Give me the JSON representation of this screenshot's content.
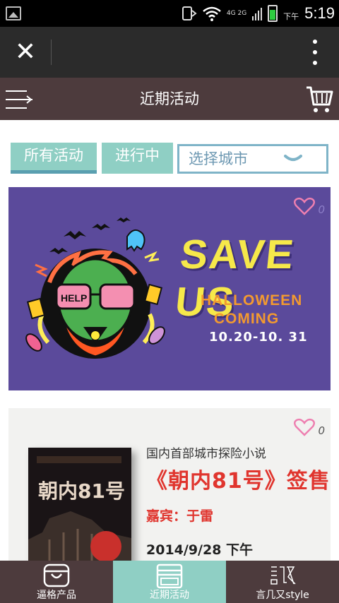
{
  "status_bar": {
    "network": "4G 2G",
    "ampm": "下午",
    "time": "5:19"
  },
  "top_bar": {
    "close_icon": "close-icon",
    "more_icon": "more-vertical-icon"
  },
  "nav": {
    "title": "近期活动",
    "menu_icon": "menu-arrow-icon",
    "cart_icon": "cart-icon"
  },
  "filters": {
    "all": "所有活动",
    "ongoing": "进行中",
    "city_label": "选择城市",
    "city_icon": "chevron-down-icon"
  },
  "events": [
    {
      "likes": "0",
      "heading": "SAVE US",
      "subheading_line1": "HALLOWEEN",
      "subheading_line2": "COMING",
      "dates": "10.20-10. 31",
      "sign_text": "HELP"
    },
    {
      "likes": "0",
      "book_title": "朝内81号",
      "subtitle": "国内首部城市探险小说",
      "title": "《朝内81号》签售",
      "guest": "嘉宾：于雷",
      "date": "2014/9/28 下午"
    }
  ],
  "bottom_nav": [
    {
      "label": "逼格产品",
      "icon": "bag-icon"
    },
    {
      "label": "近期活动",
      "icon": "calendar-icon"
    },
    {
      "label": "言几又style",
      "icon": "brand-logo-icon"
    }
  ],
  "colors": {
    "nav_brown": "#4d3b3d",
    "teal": "#8fcfc4",
    "event_purple": "#5b4a9b",
    "accent_red": "#e0352e"
  }
}
